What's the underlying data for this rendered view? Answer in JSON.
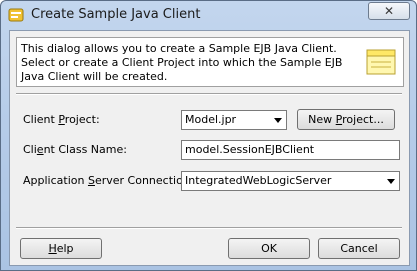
{
  "window": {
    "title": "Create Sample Java Client",
    "close_glyph": "✕"
  },
  "header": {
    "description": "This dialog allows you to create a Sample EJB Java Client. Select or create a Client Project into which the Sample EJB Java Client will be created.",
    "icon": "dialog-banner-icon"
  },
  "form": {
    "client_project": {
      "label_before": "Client ",
      "label_mnemonic": "P",
      "label_after": "roject:",
      "value": "Model.jpr"
    },
    "new_project_button": {
      "before": "New ",
      "mnemonic": "P",
      "after": "roject..."
    },
    "client_class_name": {
      "label_before": "Cli",
      "label_mnemonic": "e",
      "label_after": "nt Class Name:",
      "value": "model.SessionEJBClient"
    },
    "app_server_connection": {
      "label_before": "Application ",
      "label_mnemonic": "S",
      "label_after": "erver Connection:",
      "value": "IntegratedWebLogicServer"
    }
  },
  "footer": {
    "help": {
      "mnemonic": "H",
      "after": "elp"
    },
    "ok_label": "OK",
    "cancel_label": "Cancel"
  }
}
